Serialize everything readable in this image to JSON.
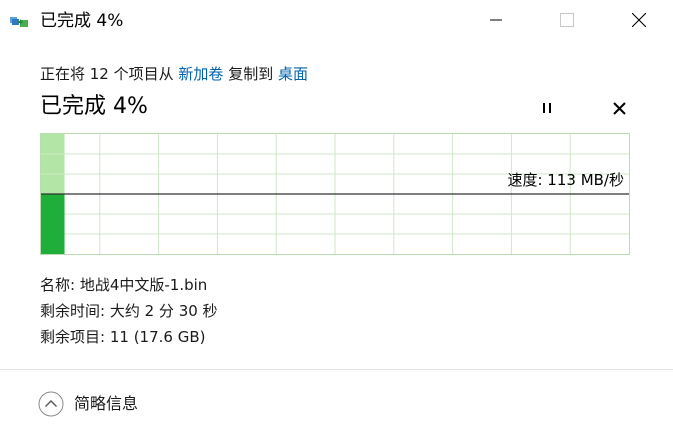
{
  "window": {
    "title": "已完成 4%"
  },
  "header": {
    "copy_prefix": "正在将 12 个项目从",
    "source_folder": "新加卷",
    "copy_middle": "复制到",
    "dest_folder": "桌面",
    "progress_title": "已完成 4%"
  },
  "progress": {
    "percent": 4
  },
  "graph": {
    "speed_text": "速度: 113 MB/秒"
  },
  "details": {
    "name_label": "名称:",
    "name_value": "地战4中文版-1.bin",
    "time_label": "剩余时间:",
    "time_value": "大约 2 分 30 秒",
    "items_label": "剩余项目:",
    "items_value": "11 (17.6 GB)"
  },
  "footer": {
    "toggle_label": "简略信息"
  },
  "colors": {
    "accent": "#0063b1",
    "progress_fill": "#b3e6a6",
    "bar_fill": "#1fae3a",
    "grid": "#cfe8c8"
  },
  "icons": {
    "app": "copy-files-icon",
    "minimize": "minimize-icon",
    "maximize": "maximize-icon",
    "close": "close-icon",
    "pause": "pause-icon",
    "cancel": "cancel-icon",
    "collapse": "chevron-up-icon"
  }
}
